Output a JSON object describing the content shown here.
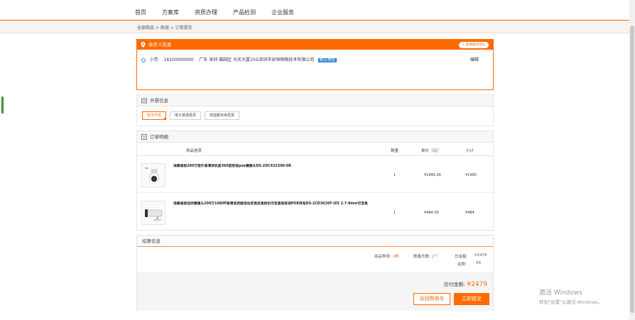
{
  "nav": {
    "items": [
      "首页",
      "方案库",
      "资质办理",
      "产品检测",
      "企业服务"
    ]
  },
  "breadcrumb": "全部商品 > 商城 > 订单提交",
  "address": {
    "title": "收货人信息",
    "new_label": "+ 新增收货地址",
    "name": "小芳",
    "phone": "18100000000",
    "detail": "广东 深圳 福田区 大庆大厦25G深圳市安恒网络技术有限公司",
    "default_tag": "默认地址",
    "edit_label": "编辑"
  },
  "invoice": {
    "title": "开票信息",
    "options": [
      "暂不开票",
      "电子普通发票",
      "增值税专用发票"
    ]
  },
  "order": {
    "title": "订单明细",
    "columns": [
      "商品信息",
      "数量",
      "单价（元）",
      "小计"
    ],
    "items": [
      {
        "name": "海康威视200万室外高清球机星360度夜视poe摄像头DS-2DC4223IW-DE",
        "qty": "1",
        "price": "¥1995.00",
        "subtotal": "¥1995"
      },
      {
        "name": "海康威视监控摄像头200万1080P高清监控器电动变焦变焦枪机可变套装夜视POE供电DS-2CD3626F-IZS 2.7-8mm可变焦",
        "qty": "1",
        "price": "¥484.00",
        "subtotal": "¥484"
      }
    ]
  },
  "settlement": {
    "title": "结算信息",
    "kinds_label": "商品种类:",
    "kinds_value": "2种",
    "count_label": "数量总数:",
    "count_value": "2个",
    "total_label": "总金额:",
    "total_value": "¥2479",
    "shipping_label": "运费:",
    "shipping_value": "¥0",
    "payable_label": "应付金额:",
    "payable_value": "¥2479",
    "back_label": "返回购物车",
    "submit_label": "立即提交"
  },
  "watermark": {
    "line1": "激活 Windows",
    "line2": "转到\"设置\"以激活 Windows。"
  },
  "colors": {
    "accent": "#ff6a00",
    "link_blue": "#2f86d6"
  }
}
